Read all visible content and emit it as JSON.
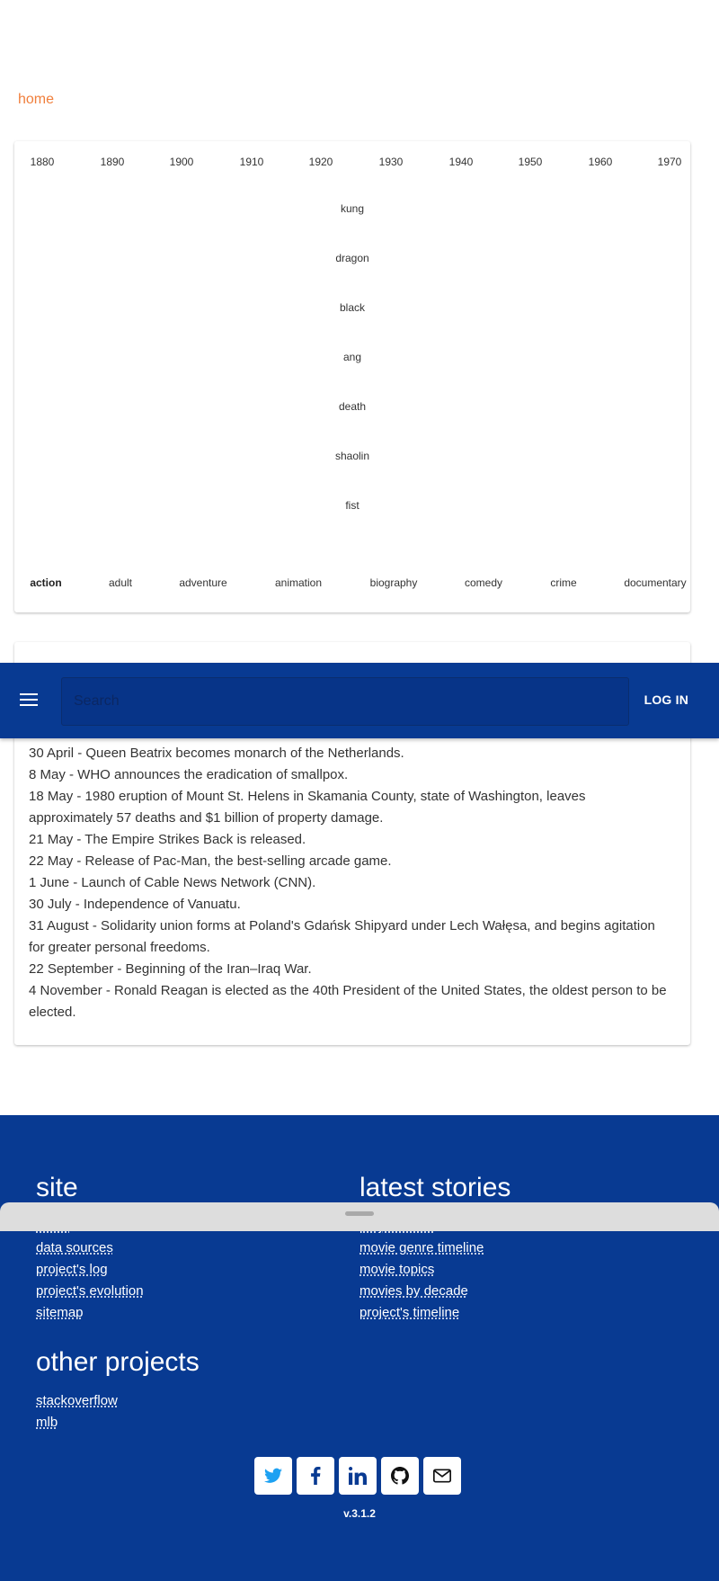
{
  "breadcrumb": {
    "home_label": "home"
  },
  "timeline": {
    "decades": [
      "1880",
      "1890",
      "1900",
      "1910",
      "1920",
      "1930",
      "1940",
      "1950",
      "1960",
      "1970"
    ],
    "words": [
      "kung",
      "dragon",
      "black",
      "ang",
      "death",
      "shaolin",
      "fist"
    ],
    "genres": [
      "action",
      "adult",
      "adventure",
      "animation",
      "biography",
      "comedy",
      "crime",
      "documentary"
    ],
    "active_genre": "action"
  },
  "events": [
    "30 April - Queen Beatrix becomes monarch of the Netherlands.",
    "8 May - WHO announces the eradication of smallpox.",
    "18 May - 1980 eruption of Mount St. Helens in Skamania County, state of Washington, leaves approximately 57 deaths and $1 billion of property damage.",
    "21 May - The Empire Strikes Back is released.",
    "22 May - Release of Pac-Man, the best-selling arcade game.",
    "1 June - Launch of Cable News Network (CNN).",
    "30 July - Independence of Vanuatu.",
    "31 August - Solidarity union forms at Poland's Gdańsk Shipyard under Lech Wałęsa, and begins agitation for greater personal freedoms.",
    "22 September - Beginning of the Iran–Iraq War.",
    "4 November - Ronald Reagan is elected as the 40th President of the United States, the oldest person to be elected."
  ],
  "appbar": {
    "menu_icon": "menu-icon",
    "search_placeholder": "Search",
    "login_label": "LOG IN"
  },
  "footer": {
    "site_title": "site",
    "site_links": [
      "about",
      "data sources",
      "project's log",
      "project's evolution",
      "sitemap"
    ],
    "stories_title": "latest stories",
    "stories_links": [
      "project's dev",
      "movie genre timeline",
      "movie topics",
      "movies by decade",
      "project's timeline"
    ],
    "other_title": "other projects",
    "other_links": [
      "stackoverflow",
      "mlb"
    ],
    "socials": [
      "twitter-icon",
      "facebook-icon",
      "linkedin-icon",
      "github-icon",
      "email-icon"
    ],
    "version": "v.3.1.2"
  },
  "colors": {
    "brand_blue": "#083a92",
    "accent_orange": "#f07f3c",
    "twitter_blue": "#1da1f2",
    "drawer_gray": "#dddddd"
  }
}
